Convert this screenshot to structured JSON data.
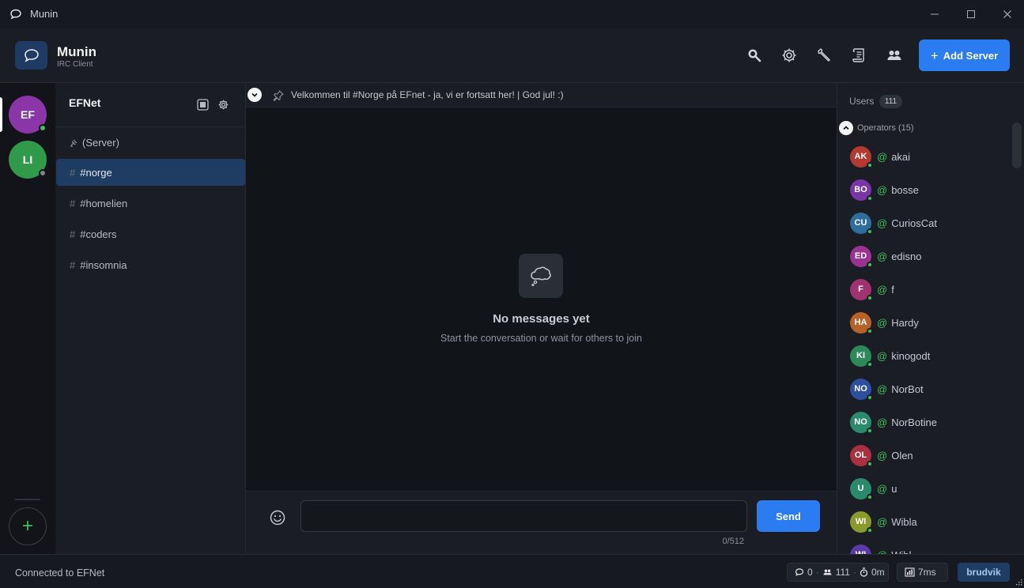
{
  "window": {
    "title": "Munin"
  },
  "header": {
    "app_name": "Munin",
    "app_subtitle": "IRC Client",
    "add_server_label": "Add Server"
  },
  "servers": [
    {
      "initials": "EF",
      "color": "#8a36a8",
      "status_color": "#3ec25a"
    },
    {
      "initials": "LI",
      "color": "#2e9a4a",
      "status_color": "#7d8390"
    }
  ],
  "network": {
    "name": "EFNet",
    "channels": [
      {
        "label": "(Server)"
      },
      {
        "label": "#norge"
      },
      {
        "label": "#homelien"
      },
      {
        "label": "#coders"
      },
      {
        "label": "#insomnia"
      }
    ]
  },
  "chat": {
    "topic": "Velkommen til #Norge på EFnet - ja, vi er fortsatt her! | God jul! :)",
    "empty_title": "No messages yet",
    "empty_subtitle": "Start the conversation or wait for others to join",
    "input_value": "",
    "send_label": "Send",
    "char_count": "0/512"
  },
  "users": {
    "label": "Users",
    "count": "111",
    "group_label": "Operators (15)",
    "list": [
      {
        "initials": "AK",
        "prefix": "@",
        "name": "akai",
        "color": "#b5392f"
      },
      {
        "initials": "BO",
        "prefix": "@",
        "name": "bosse",
        "color": "#7a35a8"
      },
      {
        "initials": "CU",
        "prefix": "@",
        "name": "CuriosCat",
        "color": "#2f6d9c"
      },
      {
        "initials": "ED",
        "prefix": "@",
        "name": "edisno",
        "color": "#9a3390"
      },
      {
        "initials": "F",
        "prefix": "@",
        "name": "f",
        "color": "#a0336f"
      },
      {
        "initials": "HA",
        "prefix": "@",
        "name": "Hardy",
        "color": "#b8622a"
      },
      {
        "initials": "KI",
        "prefix": "@",
        "name": "kinogodt",
        "color": "#2c8a58"
      },
      {
        "initials": "NO",
        "prefix": "@",
        "name": "NorBot",
        "color": "#2d4fa0"
      },
      {
        "initials": "NO",
        "prefix": "@",
        "name": "NorBotine",
        "color": "#2a8a6e"
      },
      {
        "initials": "OL",
        "prefix": "@",
        "name": "Olen",
        "color": "#a8303f"
      },
      {
        "initials": "U",
        "prefix": "@",
        "name": "u",
        "color": "#2a8a6a"
      },
      {
        "initials": "WI",
        "prefix": "@",
        "name": "Wibla",
        "color": "#8a9a2a"
      },
      {
        "initials": "WI",
        "prefix": "@",
        "name": "Wibl",
        "color": "#5a3aa8"
      }
    ]
  },
  "status": {
    "connection": "Connected to EFNet",
    "messages": "0",
    "users": "111",
    "idle": "0m",
    "latency": "7ms",
    "nick": "brudvik"
  },
  "colors": {
    "accent": "#2b7cf0",
    "online": "#3ec25a",
    "active_channel": "#1f3d63"
  }
}
